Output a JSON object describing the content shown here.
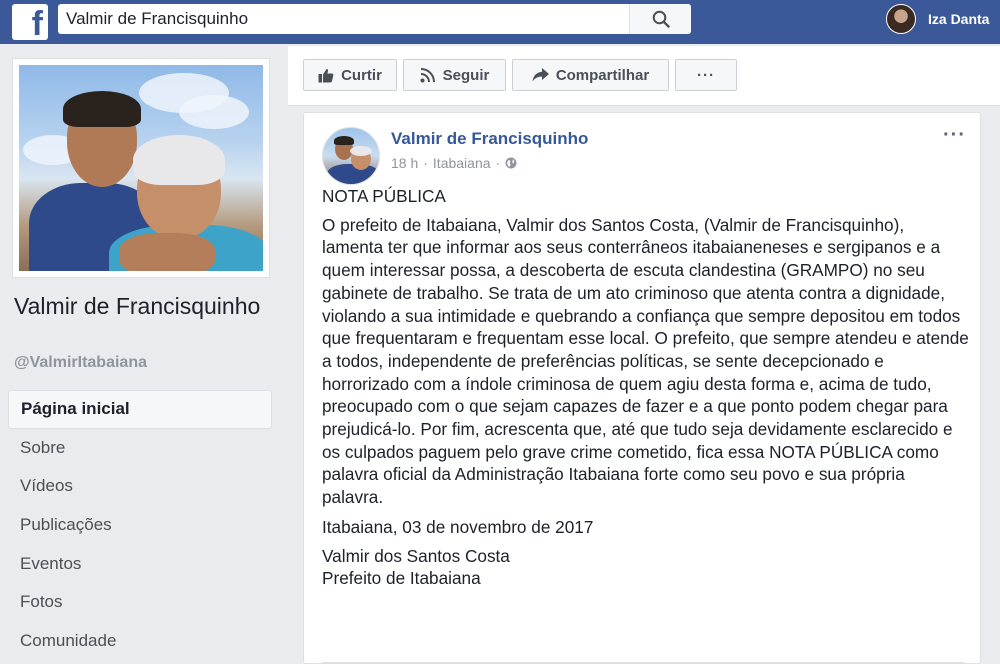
{
  "topbar": {
    "logo_letter": "f",
    "search_value": "Valmir de Francisquinho",
    "user_name": "Iza Danta",
    "icons": {
      "logo": "facebook-logo-icon",
      "search": "search-icon",
      "avatar": "user-avatar"
    }
  },
  "profile": {
    "page_name": "Valmir de Francisquinho",
    "handle": "@ValmirItabaiana"
  },
  "nav": {
    "items": [
      {
        "label": "Página inicial",
        "active": true
      },
      {
        "label": "Sobre"
      },
      {
        "label": "Vídeos"
      },
      {
        "label": "Publicações"
      },
      {
        "label": "Eventos"
      },
      {
        "label": "Fotos"
      },
      {
        "label": "Comunidade"
      }
    ]
  },
  "actions": {
    "like_label": "Curtir",
    "follow_label": "Seguir",
    "share_label": "Compartilhar",
    "more_label": "···",
    "icons": {
      "like": "thumbs-up-icon",
      "follow": "rss-icon",
      "share": "share-arrow-icon",
      "more": "more-dots-icon"
    }
  },
  "post": {
    "author": "Valmir de Francisquinho",
    "time": "18 h",
    "separator": "·",
    "location": "Itabaiana",
    "separator2": "·",
    "menu": "···",
    "heading": "NOTA PÚBLICA",
    "body": "O prefeito de Itabaiana, Valmir dos Santos Costa, (Valmir de Francisquinho), lamenta ter que informar aos seus conterrâneos itabaianeneses e sergipanos e a quem interessar possa, a descoberta de escuta clandestina (GRAMPO) no seu gabinete de trabalho. Se trata de um ato criminoso que atenta contra a dignidade, violando a sua intimidade e quebrando a confiança que sempre depositou em todos que frequentaram e frequentam esse local. O prefeito, que sempre atendeu e atende a todos, independente de preferências políticas, se sente decepcionado e horrorizado com a índole criminosa de quem agiu desta forma e, acima de tudo, preocupado com o que sejam capazes de fazer e a que ponto podem chegar para prejudicá-lo. Por fim, acrescenta que, até que tudo seja devidamente esclarecido e os culpados paguem pelo grave crime cometido, fica essa NOTA PÚBLICA como palavra oficial da Administração Itabaiana forte como seu povo e sua própria palavra.",
    "date_line": "Itabaiana, 03 de novembro de 2017",
    "signature_name": "Valmir dos Santos Costa",
    "signature_title": "Prefeito de Itabaiana",
    "icons": {
      "globe": "globe-icon",
      "menu": "more-options-icon"
    }
  },
  "colors": {
    "brand": "#3b5998",
    "link": "#365899",
    "background": "#e9ebee"
  }
}
